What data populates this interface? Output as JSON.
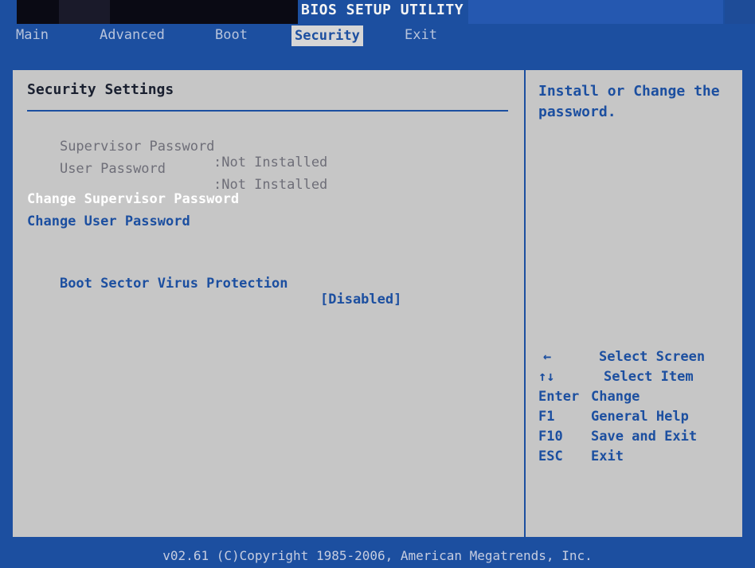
{
  "title": "BIOS SETUP UTILITY",
  "menu": {
    "items": [
      "Main",
      "Advanced",
      "Boot",
      "Security",
      "Exit"
    ],
    "selected": "Security"
  },
  "panel": {
    "section_title": "Security Settings",
    "supervisor_password": {
      "label": "Supervisor Password",
      "value": ":Not Installed"
    },
    "user_password": {
      "label": "User Password",
      "value": ":Not Installed"
    },
    "change_supervisor": "Change Supervisor Password",
    "change_user": "Change User Password",
    "boot_sector": {
      "label": "Boot Sector Virus Protection",
      "value": "[Disabled]"
    }
  },
  "help": {
    "text": "Install or Change the password.",
    "keys": [
      {
        "key": "←",
        "desc": "Select Screen"
      },
      {
        "key": "↑↓",
        "desc": "Select Item"
      },
      {
        "key": "Enter",
        "desc": "Change"
      },
      {
        "key": "F1",
        "desc": "General Help"
      },
      {
        "key": "F10",
        "desc": "Save and Exit"
      },
      {
        "key": "ESC",
        "desc": "Exit"
      }
    ]
  },
  "footer": "v02.61 (C)Copyright 1985-2006, American Megatrends, Inc.",
  "colors": {
    "background": "#1c4fa0",
    "panel": "#c6c6c6",
    "highlight": "#ffffff",
    "accent": "#1c4fa0"
  }
}
